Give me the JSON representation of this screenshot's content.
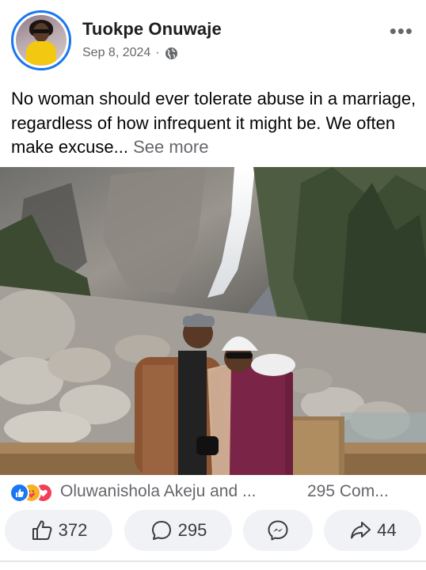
{
  "post": {
    "author_name": "Tuokpe Onuwaje",
    "date": "Sep 8, 2024",
    "separator": "·",
    "privacy_icon": "globe-icon",
    "more_icon": "more-options-icon",
    "text": "No woman should ever tolerate abuse in a marriage, regardless of how infrequent it might be. We often make excuse",
    "ellipsis": "...",
    "see_more_label": "See more"
  },
  "reactions": {
    "icons": [
      "like-icon",
      "care-icon",
      "love-icon"
    ],
    "names_text": "Oluwanishola Akeju and ...",
    "comments_text": "295 Com..."
  },
  "actions": {
    "like_count": "372",
    "comment_count": "295",
    "share_count": "44"
  },
  "colors": {
    "accent": "#1877f2",
    "secondary_text": "#65676b",
    "pill_background": "#f0f2f5"
  }
}
